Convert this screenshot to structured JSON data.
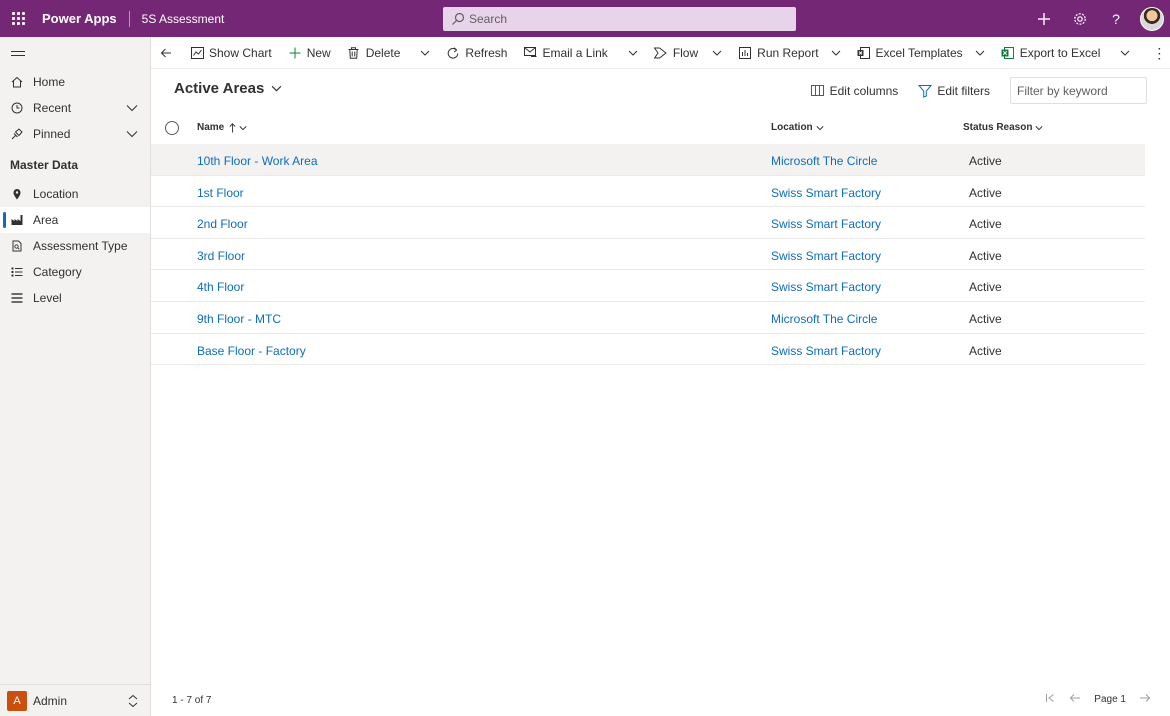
{
  "topbar": {
    "brand": "Power Apps",
    "app_name": "5S Assessment",
    "search_placeholder": "Search",
    "icons": [
      "waffle-icon",
      "search-icon",
      "add-icon",
      "settings-icon",
      "help-icon",
      "user-avatar"
    ]
  },
  "sidebar": {
    "items": [
      {
        "label": "Home",
        "icon": "home-icon"
      },
      {
        "label": "Recent",
        "icon": "clock-icon"
      },
      {
        "label": "Pinned",
        "icon": "pin-icon"
      }
    ],
    "group_label": "Master Data",
    "group_items": [
      {
        "label": "Location",
        "icon": "location-pin-icon"
      },
      {
        "label": "Area",
        "icon": "factory-icon"
      },
      {
        "label": "Assessment Type",
        "icon": "document-search-icon"
      },
      {
        "label": "Category",
        "icon": "list-bullet-icon"
      },
      {
        "label": "Level",
        "icon": "list-lines-icon"
      }
    ],
    "area_badge": "A",
    "area_label": "Admin"
  },
  "commandbar": {
    "show_chart": "Show Chart",
    "new": "New",
    "delete": "Delete",
    "refresh": "Refresh",
    "email_link": "Email a Link",
    "flow": "Flow",
    "run_report": "Run Report",
    "excel_templates": "Excel Templates",
    "export_excel": "Export to Excel"
  },
  "view": {
    "title": "Active Areas",
    "edit_columns": "Edit columns",
    "edit_filters": "Edit filters",
    "filter_placeholder": "Filter by keyword"
  },
  "grid": {
    "columns": {
      "name": "Name",
      "location": "Location",
      "status": "Status Reason"
    },
    "rows": [
      {
        "name": "10th Floor - Work Area",
        "location": "Microsoft The Circle",
        "status": "Active"
      },
      {
        "name": "1st Floor",
        "location": "Swiss Smart Factory",
        "status": "Active"
      },
      {
        "name": "2nd Floor",
        "location": "Swiss Smart Factory",
        "status": "Active"
      },
      {
        "name": "3rd Floor",
        "location": "Swiss Smart Factory",
        "status": "Active"
      },
      {
        "name": "4th Floor",
        "location": "Swiss Smart Factory",
        "status": "Active"
      },
      {
        "name": "9th Floor - MTC",
        "location": "Microsoft The Circle",
        "status": "Active"
      },
      {
        "name": "Base Floor - Factory",
        "location": "Swiss Smart Factory",
        "status": "Active"
      }
    ],
    "record_count": "1 - 7 of 7",
    "page_label": "Page 1"
  },
  "colors": {
    "brand": "#742774",
    "link": "#0f6cbd",
    "selected_indicator": "#0f6cbd",
    "excel_green": "#107c41"
  }
}
